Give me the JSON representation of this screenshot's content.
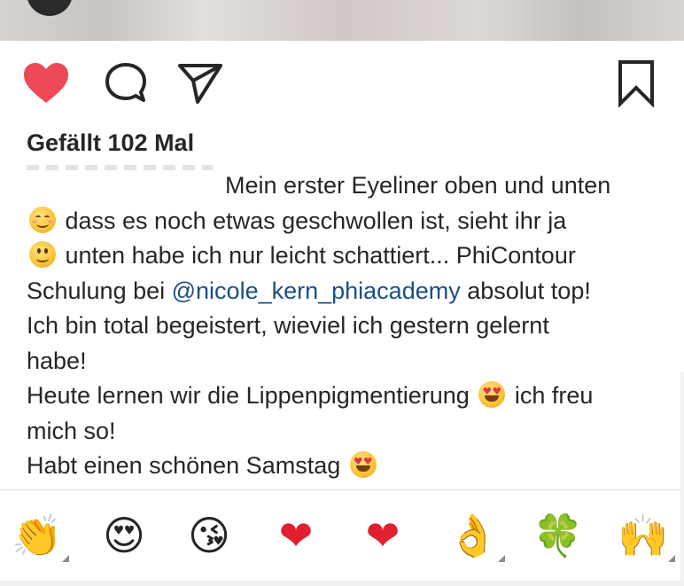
{
  "post": {
    "likes_text": "Gefällt 102 Mal",
    "caption_lines": [
      {
        "text": "Mein erster Eyeliner oben und unten",
        "indent": true
      },
      {
        "emoji": "blush",
        "text": " dass es noch etwas geschwollen ist, sieht ihr ja"
      },
      {
        "emoji": "slight",
        "text": " unten habe ich nur leicht schattiert... PhiContour"
      },
      {
        "prefix": "Schulung bei ",
        "mention": "@nicole_kern_phiacademy",
        "suffix": " absolut top!"
      },
      {
        "text": "Ich bin total begeistert, wieviel ich gestern gelernt"
      },
      {
        "text": "habe!"
      },
      {
        "text": "Heute lernen wir die Lippenpigmentierung ",
        "emoji_end": "hearts",
        "text_after": " ich freu"
      },
      {
        "text": "mich so!"
      },
      {
        "text": "Habt einen schönen Samstag ",
        "emoji_end": "hearts"
      }
    ]
  },
  "actions": {
    "like_icon": "heart-filled-icon",
    "comment_icon": "comment-icon",
    "share_icon": "send-icon",
    "save_icon": "bookmark-icon",
    "like_color": "#ed4956"
  },
  "emoji_bar": {
    "items": [
      {
        "name": "clapping-hands",
        "glyph": "👏",
        "has_variants": true
      },
      {
        "name": "heart-eyes",
        "glyph": "😍",
        "has_variants": false
      },
      {
        "name": "face-blowing-kiss",
        "glyph": "😘",
        "has_variants": false
      },
      {
        "name": "red-heart",
        "glyph": "❤",
        "has_variants": false
      },
      {
        "name": "red-heart",
        "glyph": "❤",
        "has_variants": false
      },
      {
        "name": "ok-hand",
        "glyph": "👌",
        "has_variants": true
      },
      {
        "name": "four-leaf-clover",
        "glyph": "🍀",
        "has_variants": false
      },
      {
        "name": "raising-hands",
        "glyph": "🙌",
        "has_variants": true
      }
    ]
  }
}
